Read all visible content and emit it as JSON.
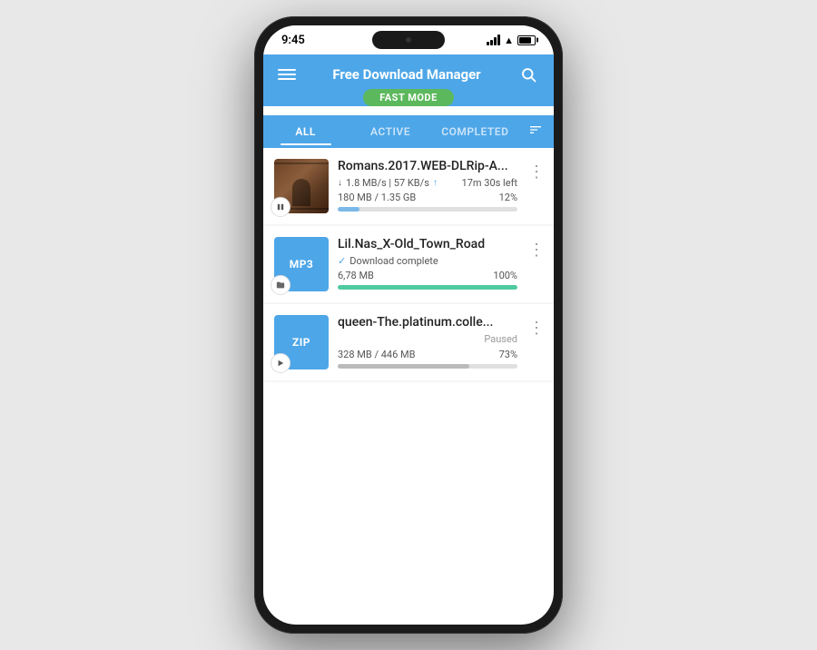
{
  "phone": {
    "status_bar": {
      "time": "9:45"
    },
    "app_bar": {
      "title": "Free Download Manager",
      "fast_mode_label": "FAST MODE"
    },
    "tabs": [
      {
        "id": "all",
        "label": "ALL",
        "active": true
      },
      {
        "id": "active",
        "label": "ACTIVE",
        "active": false
      },
      {
        "id": "completed",
        "label": "COMPLETED",
        "active": false
      }
    ],
    "downloads": [
      {
        "id": 1,
        "name": "Romans.2017.WEB-DLRip-A...",
        "type": "video",
        "speed_down": "↓1.8 MB/s",
        "speed_up": "57 KB/s ↑",
        "time_left": "17m 30s left",
        "size_done": "180 MB",
        "size_total": "1.35 GB",
        "percent": "12%",
        "progress": 12,
        "progress_color": "blue",
        "status": "downloading",
        "action_icon": "pause"
      },
      {
        "id": 2,
        "name": "Lil.Nas_X-Old_Town_Road",
        "type": "mp3",
        "type_label": "MP3",
        "complete_text": "Download complete",
        "size_done": "6,78 MB",
        "percent": "100%",
        "progress": 100,
        "progress_color": "green",
        "status": "complete",
        "action_icon": "folder"
      },
      {
        "id": 3,
        "name": "queen-The.platinum.colle...",
        "type": "zip",
        "type_label": "ZIP",
        "status_text": "Paused",
        "size_done": "328 MB",
        "size_total": "446 MB",
        "percent": "73%",
        "progress": 73,
        "progress_color": "gray",
        "status": "paused",
        "action_icon": "play"
      }
    ]
  }
}
